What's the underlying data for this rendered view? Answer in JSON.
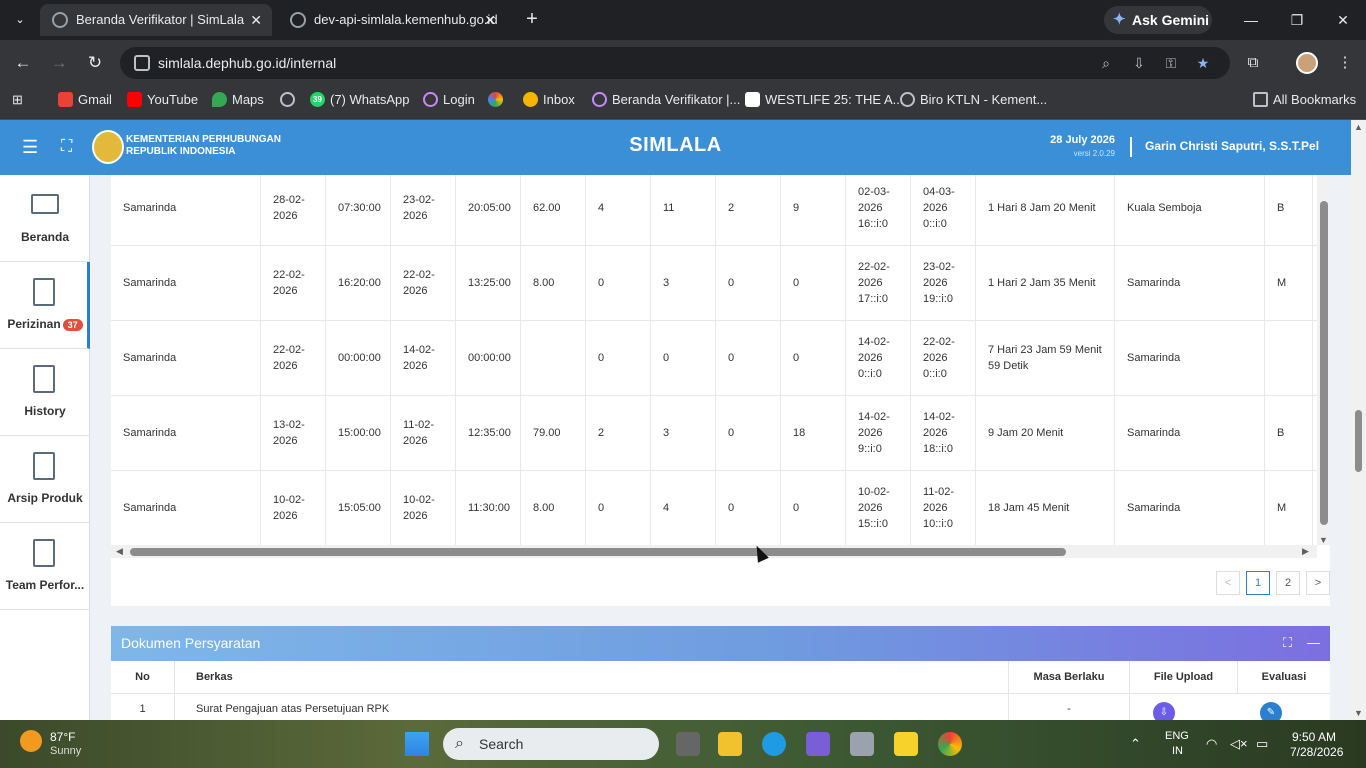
{
  "browser": {
    "tabs": [
      {
        "title": "Beranda Verifikator | SimLala",
        "active": true
      },
      {
        "title": "dev-api-simlala.kemenhub.go.id",
        "active": false
      }
    ],
    "ask_gemini": "Ask Gemini",
    "url": "simlala.dephub.go.id/internal",
    "bookmarks": [
      "Gmail",
      "YouTube",
      "Maps",
      "(7) WhatsApp",
      "Login",
      "Inbox",
      "Beranda Verifikator |...",
      "WESTLIFE 25: THE A...",
      "Biro KTLN - Kement..."
    ],
    "whatsapp_badge": "39",
    "all_bookmarks": "All Bookmarks"
  },
  "header": {
    "ministry_line1": "KEMENTERIAN PERHUBUNGAN",
    "ministry_line2": "REPUBLIK INDONESIA",
    "app_name": "SIMLALA",
    "date": "28 July 2026",
    "version": "versi 2.0.29",
    "user": "Garin Christi Saputri, S.S.T.Pel"
  },
  "sidebar": {
    "items": [
      {
        "label": "Beranda",
        "icon": "monitor-icon"
      },
      {
        "label": "Perizinan",
        "icon": "document-icon",
        "badge": "37"
      },
      {
        "label": "History",
        "icon": "document-icon"
      },
      {
        "label": "Arsip Produk",
        "icon": "document-icon"
      },
      {
        "label": "Team Perfor...",
        "icon": "document-icon"
      }
    ]
  },
  "table": {
    "rows": [
      [
        "Samarinda",
        "28-02-\n2026",
        "07:30:00",
        "23-02-\n2026",
        "20:05:00",
        "62.00",
        "4",
        "11",
        "2",
        "9",
        "02-03-\n2026\n16::i:0",
        "04-03-\n2026\n0::i:0",
        "1 Hari 8 Jam 20 Menit",
        "Kuala Semboja",
        "B"
      ],
      [
        "Samarinda",
        "22-02-\n2026",
        "16:20:00",
        "22-02-\n2026",
        "13:25:00",
        "8.00",
        "0",
        "3",
        "0",
        "0",
        "22-02-\n2026\n17::i:0",
        "23-02-\n2026\n19::i:0",
        "1 Hari 2 Jam 35 Menit",
        "Samarinda",
        "M"
      ],
      [
        "Samarinda",
        "22-02-\n2026",
        "00:00:00",
        "14-02-\n2026",
        "00:00:00",
        "",
        "0",
        "0",
        "0",
        "0",
        "14-02-\n2026\n0::i:0",
        "22-02-\n2026\n0::i:0",
        "7 Hari 23 Jam 59 Menit\n59 Detik",
        "Samarinda",
        ""
      ],
      [
        "Samarinda",
        "13-02-\n2026",
        "15:00:00",
        "11-02-\n2026",
        "12:35:00",
        "79.00",
        "2",
        "3",
        "0",
        "18",
        "14-02-\n2026\n9::i:0",
        "14-02-\n2026\n18::i:0",
        "9 Jam 20 Menit",
        "Samarinda",
        "B"
      ],
      [
        "Samarinda",
        "10-02-\n2026",
        "15:05:00",
        "10-02-\n2026",
        "11:30:00",
        "8.00",
        "0",
        "4",
        "0",
        "0",
        "10-02-\n2026\n15::i:0",
        "11-02-\n2026\n10::i:0",
        "18 Jam 45 Menit",
        "Samarinda",
        "M"
      ]
    ],
    "pagination": {
      "prev": "<",
      "pages": [
        "1",
        "2"
      ],
      "next": ">"
    }
  },
  "dokumen": {
    "title": "Dokumen Persyaratan",
    "headers": [
      "No",
      "Berkas",
      "Masa Berlaku",
      "File Upload",
      "Evaluasi"
    ],
    "rows": [
      {
        "no": "1",
        "berkas": "Surat Pengajuan atas Persetujuan RPK",
        "masa_berlaku": "-"
      }
    ]
  },
  "taskbar": {
    "temp": "87°F",
    "condition": "Sunny",
    "search": "Search",
    "lang1": "ENG",
    "lang2": "IN",
    "time": "9:50 AM",
    "date": "7/28/2026"
  },
  "colors": {
    "header": "#3a8fd6",
    "accent": "#2a7fd0",
    "badge": "#e74c3c"
  }
}
